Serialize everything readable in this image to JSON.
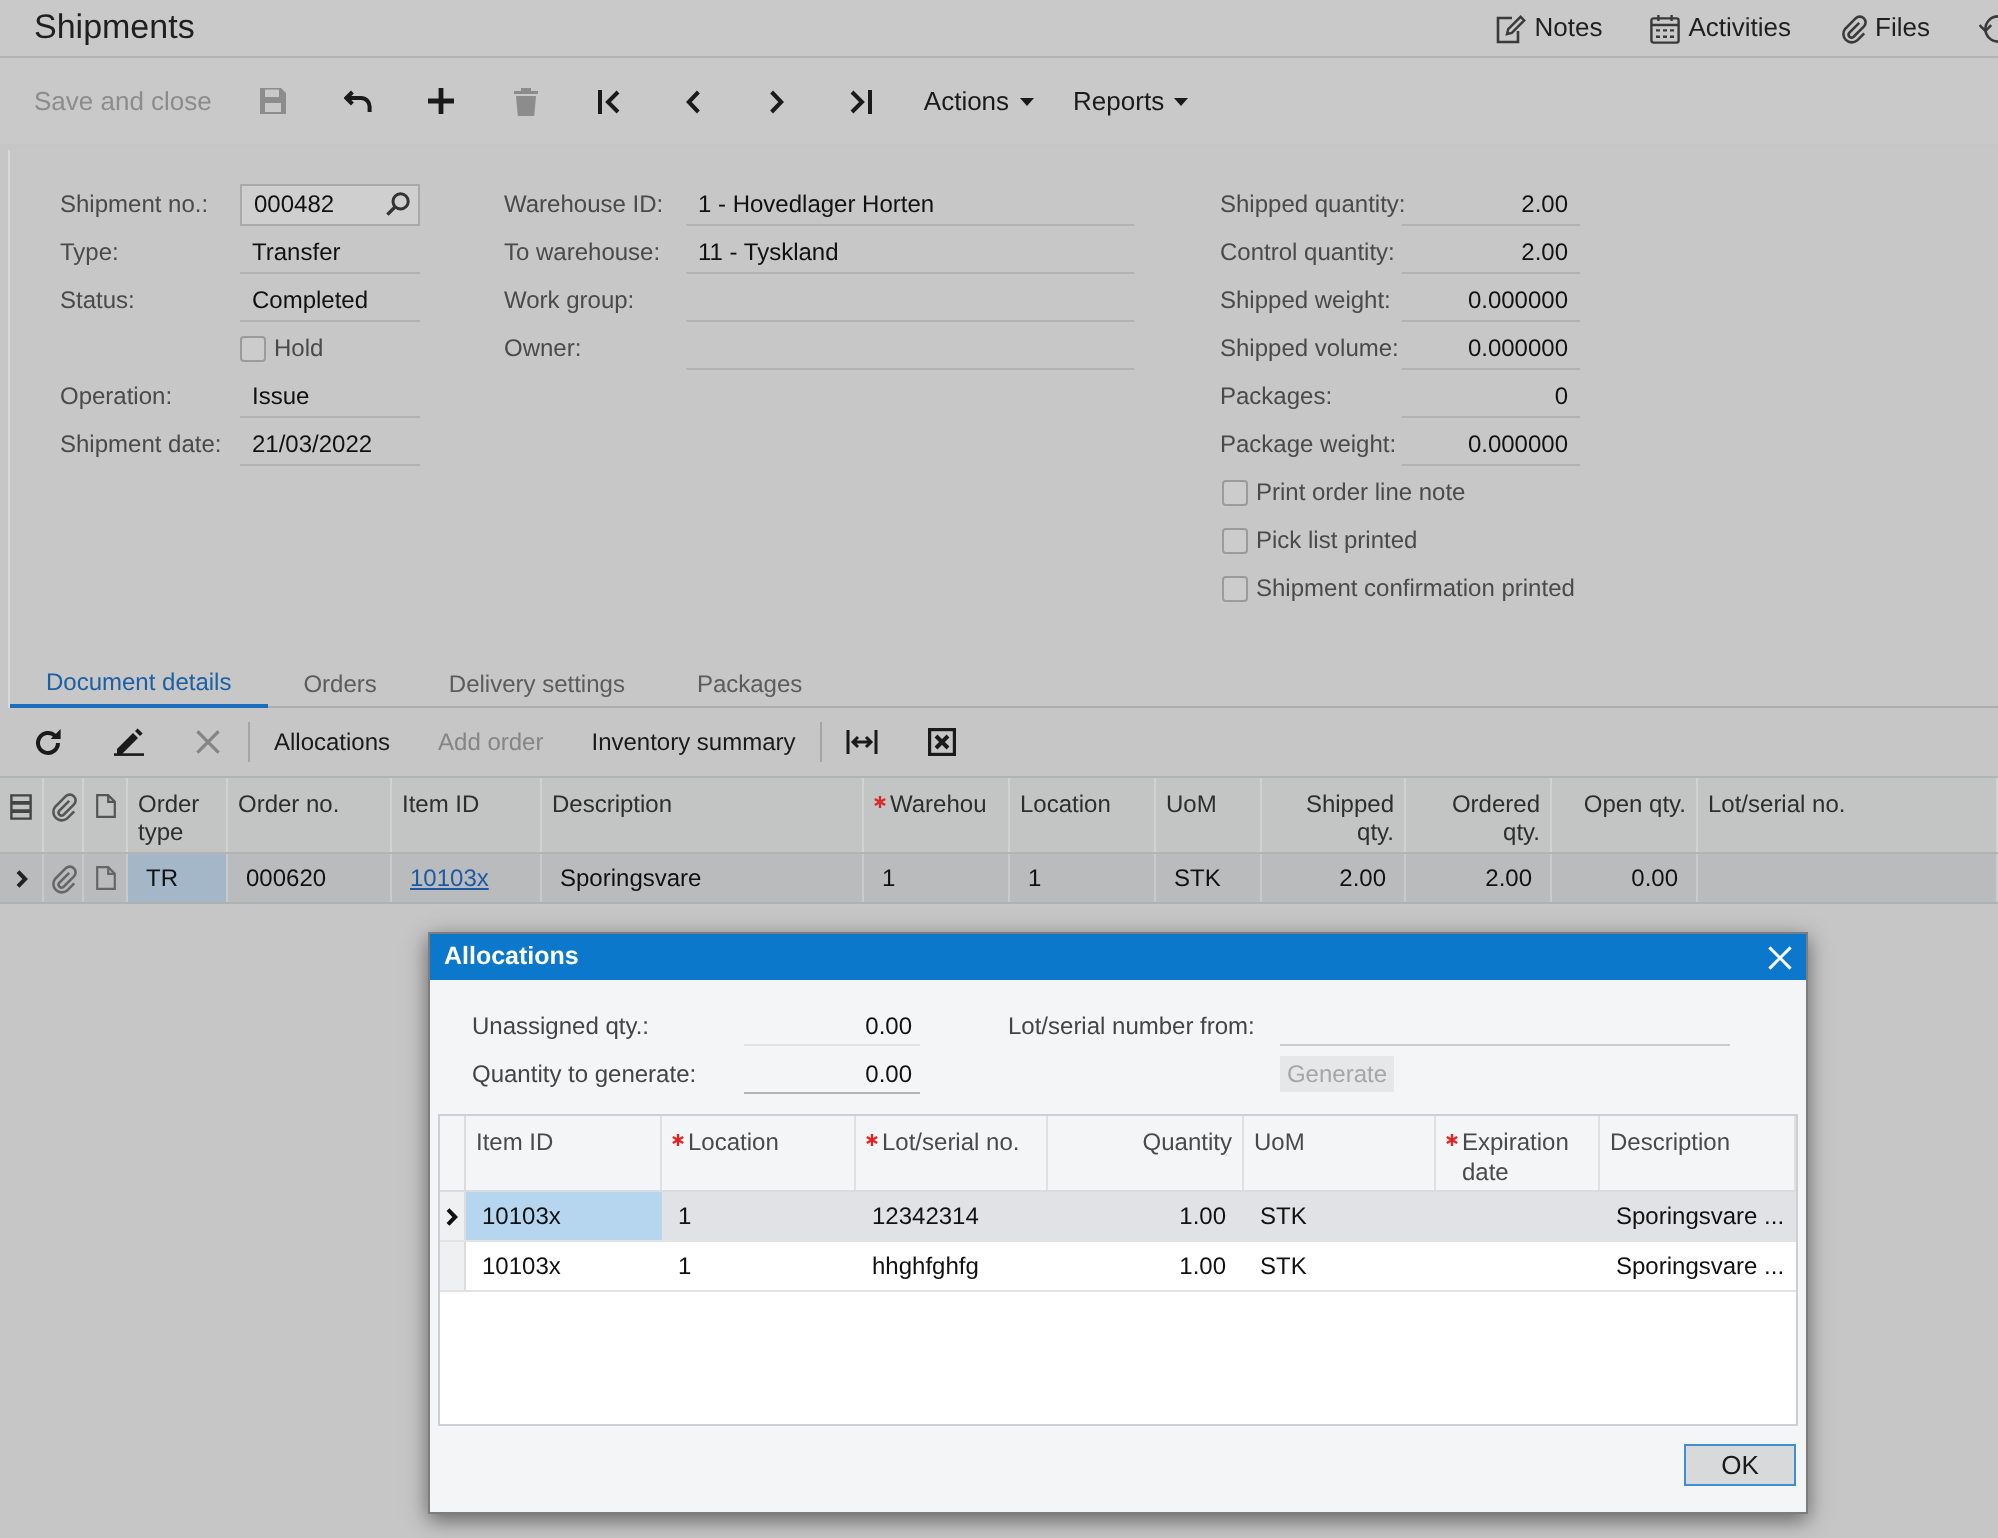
{
  "header": {
    "title": "Shipments",
    "links": [
      {
        "label": "Notes"
      },
      {
        "label": "Activities"
      },
      {
        "label": "Files"
      }
    ]
  },
  "toolbar": [
    {
      "kind": "text",
      "label": "Save and close",
      "disabled": true
    },
    {
      "kind": "icon",
      "disabled": true
    },
    {
      "kind": "icon",
      "disabled": false
    },
    {
      "kind": "icon",
      "disabled": false
    },
    {
      "kind": "icon",
      "disabled": true
    },
    {
      "kind": "icon",
      "disabled": false
    },
    {
      "kind": "icon",
      "disabled": false
    },
    {
      "kind": "icon",
      "disabled": false
    },
    {
      "kind": "icon",
      "disabled": false
    },
    {
      "kind": "menu",
      "label": "Actions",
      "disabled": false
    },
    {
      "kind": "menu",
      "label": "Reports",
      "disabled": false
    }
  ],
  "form": {
    "columns": [
      [
        {
          "kind": "lookup",
          "label": "Shipment no.:",
          "value": "000482"
        },
        {
          "kind": "field",
          "label": "Type:",
          "value": "Transfer"
        },
        {
          "kind": "field",
          "label": "Status:",
          "value": "Completed"
        },
        {
          "kind": "checkbox",
          "label": "Hold",
          "checked": false
        },
        {
          "kind": "field",
          "label": "Operation:",
          "value": "Issue"
        },
        {
          "kind": "field",
          "label": "Shipment date:",
          "value": "21/03/2022"
        }
      ],
      [
        {
          "kind": "field",
          "label": "Warehouse ID:",
          "value": "1 - Hovedlager Horten"
        },
        {
          "kind": "field",
          "label": "To warehouse:",
          "value": "11 - Tyskland"
        },
        {
          "kind": "field",
          "label": "Work group:"
        },
        {
          "kind": "field",
          "label": "Owner:"
        }
      ],
      [
        {
          "kind": "number",
          "label": "Shipped quantity:",
          "value": "2.00"
        },
        {
          "kind": "number",
          "label": "Control quantity:",
          "value": "2.00"
        },
        {
          "kind": "number",
          "label": "Shipped weight:",
          "value": "0.000000"
        },
        {
          "kind": "number",
          "label": "Shipped volume:",
          "value": "0.000000"
        },
        {
          "kind": "number",
          "label": "Packages:",
          "value": "0"
        },
        {
          "kind": "number",
          "label": "Package weight:",
          "value": "0.000000"
        },
        {
          "kind": "checkbox",
          "label": "Print order line note",
          "checked": false
        },
        {
          "kind": "checkbox",
          "label": "Pick list printed",
          "checked": false
        },
        {
          "kind": "checkbox",
          "label": "Shipment confirmation printed",
          "checked": false
        }
      ]
    ]
  },
  "tabs": [
    {
      "label": "Document details",
      "selected": true
    },
    {
      "label": "Orders",
      "selected": false
    },
    {
      "label": "Delivery settings",
      "selected": false
    },
    {
      "label": "Packages",
      "selected": false
    }
  ],
  "grid_toolbar": {
    "groups": [
      [
        {
          "kind": "icon",
          "disabled": false
        },
        {
          "kind": "icon",
          "disabled": false
        },
        {
          "kind": "icon",
          "disabled": true
        }
      ],
      [
        {
          "kind": "text",
          "label": "Allocations",
          "disabled": false
        },
        {
          "kind": "text",
          "label": "Add order",
          "disabled": true
        },
        {
          "kind": "text",
          "label": "Inventory summary",
          "disabled": false
        }
      ],
      [
        {
          "kind": "icon",
          "disabled": false
        },
        {
          "kind": "icon",
          "disabled": false
        }
      ]
    ]
  },
  "grid": {
    "columns": [
      {
        "label": "Order type",
        "kind": "text",
        "required": false
      },
      {
        "label": "Order no.",
        "kind": "text",
        "required": false
      },
      {
        "label": "Item ID",
        "kind": "text",
        "required": false
      },
      {
        "label": "Description",
        "kind": "text",
        "required": false
      },
      {
        "label": "Warehou",
        "kind": "text",
        "required": true
      },
      {
        "label": "Location",
        "kind": "text",
        "required": false
      },
      {
        "label": "UoM",
        "kind": "text",
        "required": false
      },
      {
        "label": "Shipped qty.",
        "kind": "number",
        "required": false
      },
      {
        "label": "Ordered qty.",
        "kind": "number",
        "required": false
      },
      {
        "label": "Open qty.",
        "kind": "number",
        "required": false
      },
      {
        "label": "Lot/serial no.",
        "kind": "text",
        "required": false
      }
    ],
    "rows": [
      {
        "selected": true,
        "cells": [
          {
            "text": "TR",
            "kind": "text",
            "focused": true
          },
          {
            "text": "000620",
            "kind": "text",
            "focused": false
          },
          {
            "text": "10103x",
            "kind": "link",
            "focused": false
          },
          {
            "text": "Sporingsvare",
            "kind": "text",
            "focused": false
          },
          {
            "text": "1",
            "kind": "text",
            "focused": false
          },
          {
            "text": "1",
            "kind": "text",
            "focused": false
          },
          {
            "text": "STK",
            "kind": "text",
            "focused": false
          },
          {
            "text": "2.00",
            "kind": "text",
            "focused": false
          },
          {
            "text": "2.00",
            "kind": "text",
            "focused": false
          },
          {
            "text": "0.00",
            "kind": "text",
            "focused": false
          }
        ]
      }
    ]
  },
  "dialog": {
    "title": "Allocations",
    "fields": [
      {
        "label": "Unassigned qty.:",
        "value": "0.00"
      },
      {
        "label": "Quantity to generate:",
        "value": "0.00"
      }
    ],
    "lot_from": {
      "label": "Lot/serial number from:"
    },
    "generate_button": {
      "label": "Generate",
      "disabled": true
    },
    "grid": {
      "columns": [
        {
          "label": "Item ID",
          "kind": "text",
          "required": false
        },
        {
          "label": "Location",
          "kind": "text",
          "required": true
        },
        {
          "label": "Lot/serial no.",
          "kind": "text",
          "required": true
        },
        {
          "label": "Quantity",
          "kind": "number",
          "required": false
        },
        {
          "label": "UoM",
          "kind": "text",
          "required": false
        },
        {
          "label": "Expiration date",
          "kind": "text",
          "required": true
        },
        {
          "label": "Description",
          "kind": "text",
          "required": false
        }
      ],
      "rows": [
        {
          "selected": true,
          "cells": [
            {
              "text": "10103x",
              "focused": true
            },
            {
              "text": "1",
              "focused": false
            },
            {
              "text": "12342314",
              "focused": false
            },
            {
              "text": "1.00",
              "focused": false
            },
            {
              "text": "STK",
              "focused": false
            },
            {
              "focused": false
            },
            {
              "text": "Sporingsvare ...",
              "focused": false
            }
          ]
        },
        {
          "selected": false,
          "cells": [
            {
              "text": "10103x",
              "focused": false
            },
            {
              "text": "1",
              "focused": false
            },
            {
              "text": "hhghfghfg",
              "focused": false
            },
            {
              "text": "1.00",
              "focused": false
            },
            {
              "text": "STK",
              "focused": false
            },
            {
              "focused": false
            },
            {
              "text": "Sporingsvare ...",
              "focused": false
            }
          ]
        }
      ]
    },
    "ok_button": {
      "label": "OK"
    }
  }
}
